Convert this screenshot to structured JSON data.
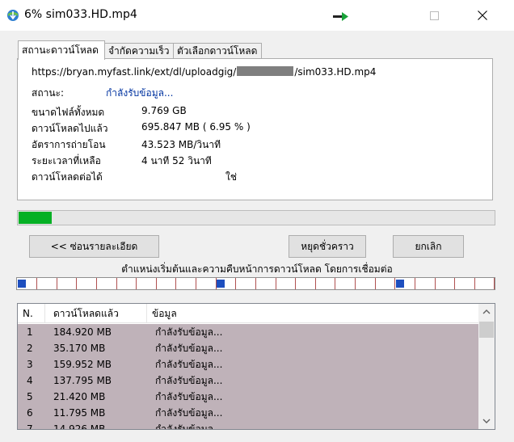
{
  "window": {
    "title": "6% sim033.HD.mp4",
    "maximize_icon": "maximize-icon",
    "close_icon": "close-icon"
  },
  "tabs": [
    {
      "label": "สถานะดาวน์โหลด",
      "active": true
    },
    {
      "label": "จำกัดความเร็ว",
      "active": false
    },
    {
      "label": "ตัวเลือกดาวน์โหลด",
      "active": false
    }
  ],
  "status_panel": {
    "url_prefix": "https://bryan.myfast.link/ext/dl/uploadgig/",
    "url_suffix": "/sim033.HD.mp4",
    "status_label": "สถานะ:",
    "status_value": "กำลังรับข้อมูล...",
    "info": [
      {
        "label": "ขนาดไฟล์ทั้งหมด",
        "value": "9.769  GB"
      },
      {
        "label": "ดาวน์โหลดไปแล้ว",
        "value": "695.847  MB  ( 6.95 % )"
      },
      {
        "label": "อัตราการถ่ายโอน",
        "value": "43.523  MB/วินาที"
      },
      {
        "label": "ระยะเวลาที่เหลือ",
        "value": "4 นาที 52 วินาที"
      },
      {
        "label": "ดาวน์โหลดต่อได้",
        "value": "ใช่"
      }
    ]
  },
  "progress": {
    "percent": 6.95,
    "color": "#06b025"
  },
  "buttons": {
    "hide_details": "<< ซ่อนรายละเอียด",
    "pause": "หยุดชั่วคราว",
    "cancel": "ยกเลิก"
  },
  "connections_caption": "ตำแหน่งเริ่มต้นและความคืบหน้าการดาวน์โหลด โดยการเชื่อมต่อ",
  "segments": {
    "count": 24,
    "marked": [
      0,
      10,
      19
    ]
  },
  "connection_list": {
    "columns": [
      "N.",
      "ดาวน์โหลดแล้ว",
      "ข้อมูล"
    ],
    "rows": [
      {
        "n": "1",
        "downloaded": "184.920  MB",
        "info": "กำลังรับข้อมูล..."
      },
      {
        "n": "2",
        "downloaded": "35.170  MB",
        "info": "กำลังรับข้อมูล..."
      },
      {
        "n": "3",
        "downloaded": "159.952  MB",
        "info": "กำลังรับข้อมูล..."
      },
      {
        "n": "4",
        "downloaded": "137.795  MB",
        "info": "กำลังรับข้อมูล..."
      },
      {
        "n": "5",
        "downloaded": "21.420  MB",
        "info": "กำลังรับข้อมูล..."
      },
      {
        "n": "6",
        "downloaded": "11.795  MB",
        "info": "กำลังรับข้อมูล..."
      },
      {
        "n": "7",
        "downloaded": "14.926  MB",
        "info": "กำลังรับข้อมูล..."
      }
    ],
    "row_color": "#bfb2b9"
  }
}
